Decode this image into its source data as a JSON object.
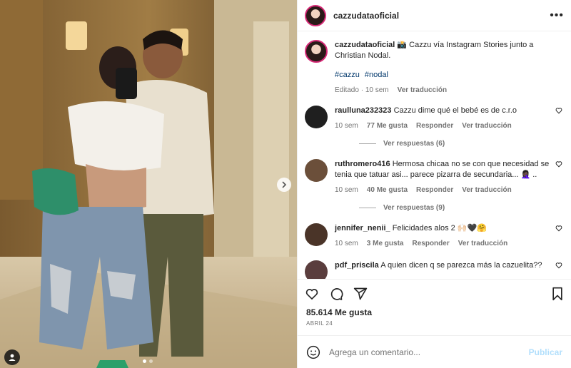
{
  "post": {
    "username": "cazzudataoficial",
    "more_icon": "more-horizontal-icon",
    "caption": {
      "username": "cazzudataoficial",
      "text": "📸 Cazzu vía Instagram Stories junto a Christian Nodal.",
      "hashtags": [
        "#cazzu",
        "#nodal"
      ],
      "edited": "Editado",
      "time": "10 sem",
      "translate": "Ver traducción"
    },
    "carousel": {
      "slides": 2,
      "active_slide": 1
    }
  },
  "comments": [
    {
      "username": "raulluna232323",
      "text": "Cazzu dime qué el bebé es de c.r.o",
      "time": "10 sem",
      "likes": "77 Me gusta",
      "reply": "Responder",
      "translate": "Ver traducción",
      "replies_label": "Ver respuestas (6)",
      "avatar_color": "#1f1f1f"
    },
    {
      "username": "ruthromero416",
      "text": "Hermosa chicaa no se con que necesidad se tenia que tatuar asi... parece pizarra de secundaria... 🤦🏿‍♀️ ..",
      "time": "10 sem",
      "likes": "40 Me gusta",
      "reply": "Responder",
      "translate": "Ver traducción",
      "replies_label": "Ver respuestas (9)",
      "avatar_color": "#6b4f3a"
    },
    {
      "username": "jennifer_nenii_",
      "text": "Felicidades alos 2 🙌🏻🖤🤗",
      "time": "10 sem",
      "likes": "3 Me gusta",
      "reply": "Responder",
      "translate": "Ver traducción",
      "avatar_color": "#4a3428"
    },
    {
      "username": "pdf_priscila",
      "text": "A quien dicen q se parezca más la cazuelita??",
      "avatar_color": "#5a3d3d"
    }
  ],
  "actions": {
    "like_icon": "heart-icon",
    "comment_icon": "comment-icon",
    "share_icon": "send-icon",
    "save_icon": "bookmark-icon"
  },
  "likes_count": "85.614 Me gusta",
  "date": "ABRIL 24",
  "composer": {
    "placeholder": "Agrega un comentario...",
    "post_label": "Publicar",
    "emoji_icon": "emoji-icon"
  },
  "colors": {
    "hashtag": "#00376b",
    "muted": "#737373",
    "post_disabled": "#b2dffc",
    "story_ring": "#d62976"
  }
}
